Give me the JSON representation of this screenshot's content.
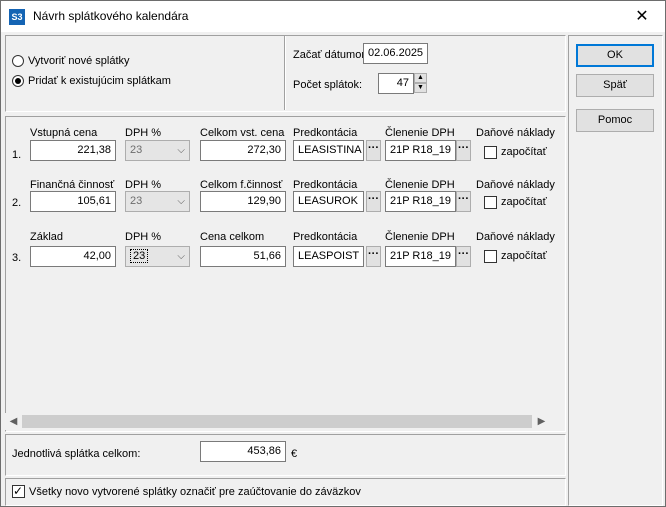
{
  "window": {
    "title": "Návrh splátkového kalendára",
    "app_icon": "S3",
    "close": "✕"
  },
  "options": {
    "create_new": "Vytvoriť nové splátky",
    "add_existing": "Pridať k existujúcim splátkam",
    "selected": "add_existing"
  },
  "start": {
    "label": "Začať dátumom",
    "value": "02.06.2025"
  },
  "count": {
    "label": "Počet splátok:",
    "value": "47"
  },
  "buttons": {
    "ok": "OK",
    "back": "Späť",
    "help": "Pomoc"
  },
  "rows": [
    {
      "num": "1.",
      "amount_label": "Vstupná cena",
      "amount": "221,38",
      "vat_label": "DPH %",
      "vat": "23",
      "total_label": "Celkom vst. cena",
      "total": "272,30",
      "precont_label": "Predkontácia",
      "precont": "LEASISTINA",
      "vatsplit_label": "Členenie DPH",
      "vatsplit": "21P R18_19",
      "tax_label": "Daňové náklady",
      "tax_check": "započítať",
      "tax_checked": false
    },
    {
      "num": "2.",
      "amount_label": "Finančná činnosť",
      "amount": "105,61",
      "vat_label": "DPH %",
      "vat": "23",
      "total_label": "Celkom f.činnosť",
      "total": "129,90",
      "precont_label": "Predkontácia",
      "precont": "LEASUROK",
      "vatsplit_label": "Členenie DPH",
      "vatsplit": "21P R18_19",
      "tax_label": "Daňové náklady",
      "tax_check": "započítať",
      "tax_checked": false
    },
    {
      "num": "3.",
      "amount_label": "Základ",
      "amount": "42,00",
      "vat_label": "DPH %",
      "vat": "23",
      "total_label": "Cena celkom",
      "total": "51,66",
      "precont_label": "Predkontácia",
      "precont": "LEASPOIST",
      "vatsplit_label": "Členenie DPH",
      "vatsplit": "21P R18_19",
      "tax_label": "Daňové náklady",
      "tax_check": "započítať",
      "tax_checked": false
    }
  ],
  "summary": {
    "label": "Jednotlivá splátka celkom:",
    "value": "453,86",
    "currency": "€"
  },
  "mark_all": {
    "label": "Všetky novo vytvorené splátky označiť pre zaúčtovanie do záväzkov",
    "checked": true
  },
  "dots": "···"
}
